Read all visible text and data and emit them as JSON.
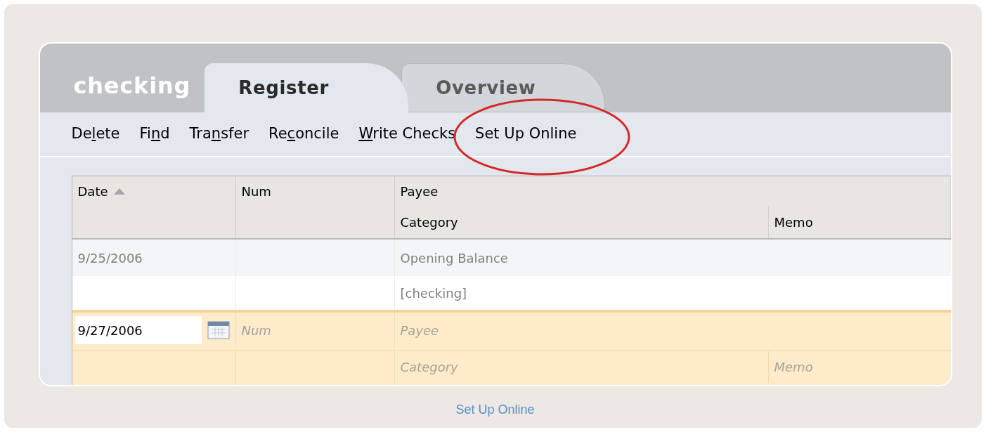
{
  "account_name": "checking",
  "tabs": [
    {
      "label": "Register",
      "selected": true
    },
    {
      "label": "Overview",
      "selected": false
    }
  ],
  "toolbar": [
    {
      "before": "De",
      "key": "l",
      "after": "ete",
      "highlighted": false
    },
    {
      "before": "Fi",
      "key": "n",
      "after": "d",
      "highlighted": false
    },
    {
      "before": "Tra",
      "key": "n",
      "after": "sfer",
      "highlighted": false
    },
    {
      "before": "Re",
      "key": "c",
      "after": "oncile",
      "highlighted": false
    },
    {
      "key": "W",
      "after": "rite Checks",
      "highlighted": false
    },
    {
      "before": "Set Up Online",
      "highlighted": true
    }
  ],
  "header": {
    "row_1": [
      {
        "label": "Date",
        "sorted_ascending": true
      },
      {
        "label": "Num"
      },
      {
        "label": "Payee"
      }
    ],
    "row_2": [
      {
        "label": "Category"
      },
      {
        "label": "Memo"
      }
    ]
  },
  "transactions": [
    {
      "date": "9/25/2006",
      "payee": "Opening Balance",
      "category": "[checking]"
    }
  ],
  "new_entry": {
    "date": {
      "value": "9/27/2006"
    },
    "num": {
      "placeholder": "Num"
    },
    "payee": {
      "placeholder": "Payee"
    },
    "category": {
      "placeholder": "Category"
    },
    "memo": {
      "placeholder": "Memo"
    }
  },
  "caption": "Set Up Online"
}
